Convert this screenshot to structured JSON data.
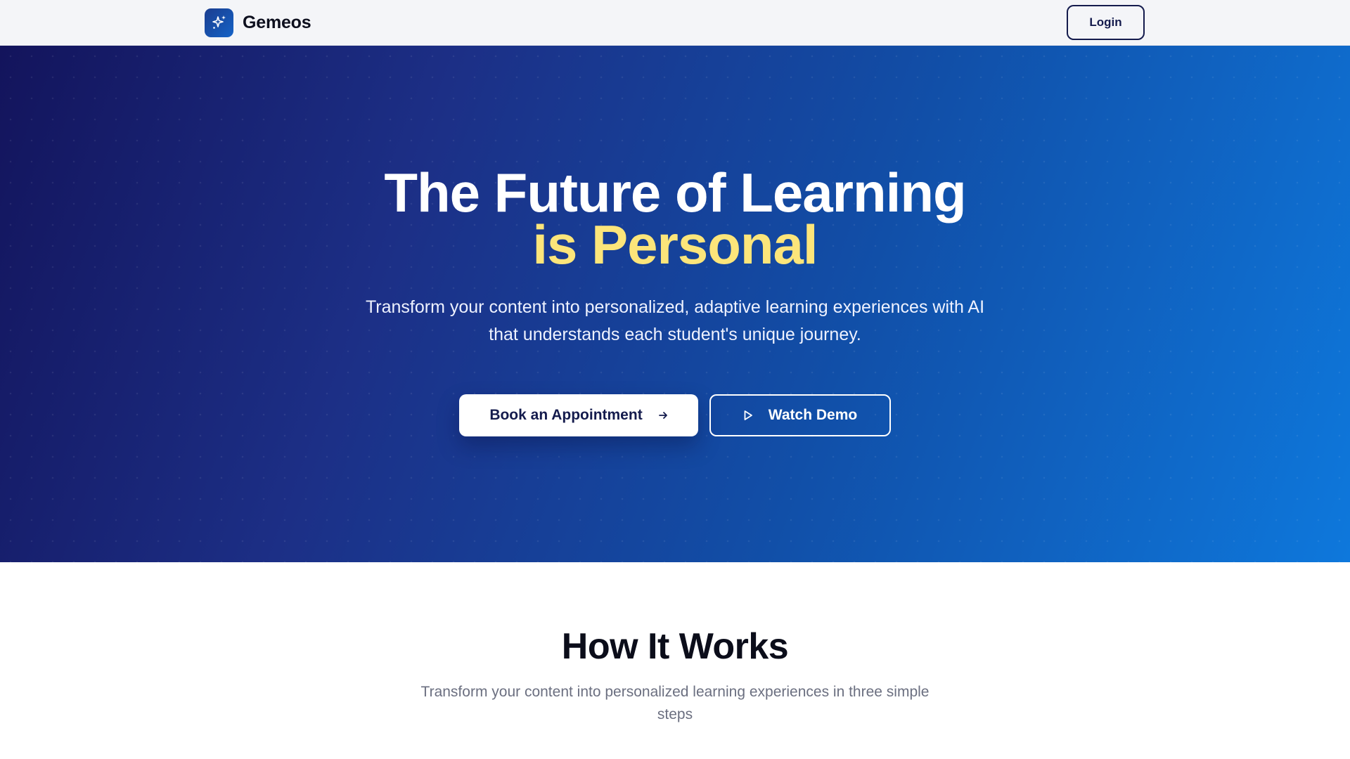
{
  "nav": {
    "brand_name": "Gemeos",
    "login_label": "Login"
  },
  "hero": {
    "title_line1": "The Future of Learning",
    "title_line2": "is Personal",
    "subtitle": "Transform your content into personalized, adaptive learning experiences with AI that understands each student's unique journey.",
    "primary_cta": "Book an Appointment",
    "secondary_cta": "Watch Demo"
  },
  "how_it_works": {
    "title": "How It Works",
    "subtitle": "Transform your content into personalized learning experiences in three simple steps"
  },
  "icons": {
    "brand": "sparkles-icon",
    "primary_cta": "arrow-right-icon",
    "secondary_cta": "play-icon"
  },
  "colors": {
    "accent_yellow": "#fce57a",
    "navy": "#141b4d",
    "hero_start": "#13145c",
    "hero_end": "#0e78dc"
  }
}
